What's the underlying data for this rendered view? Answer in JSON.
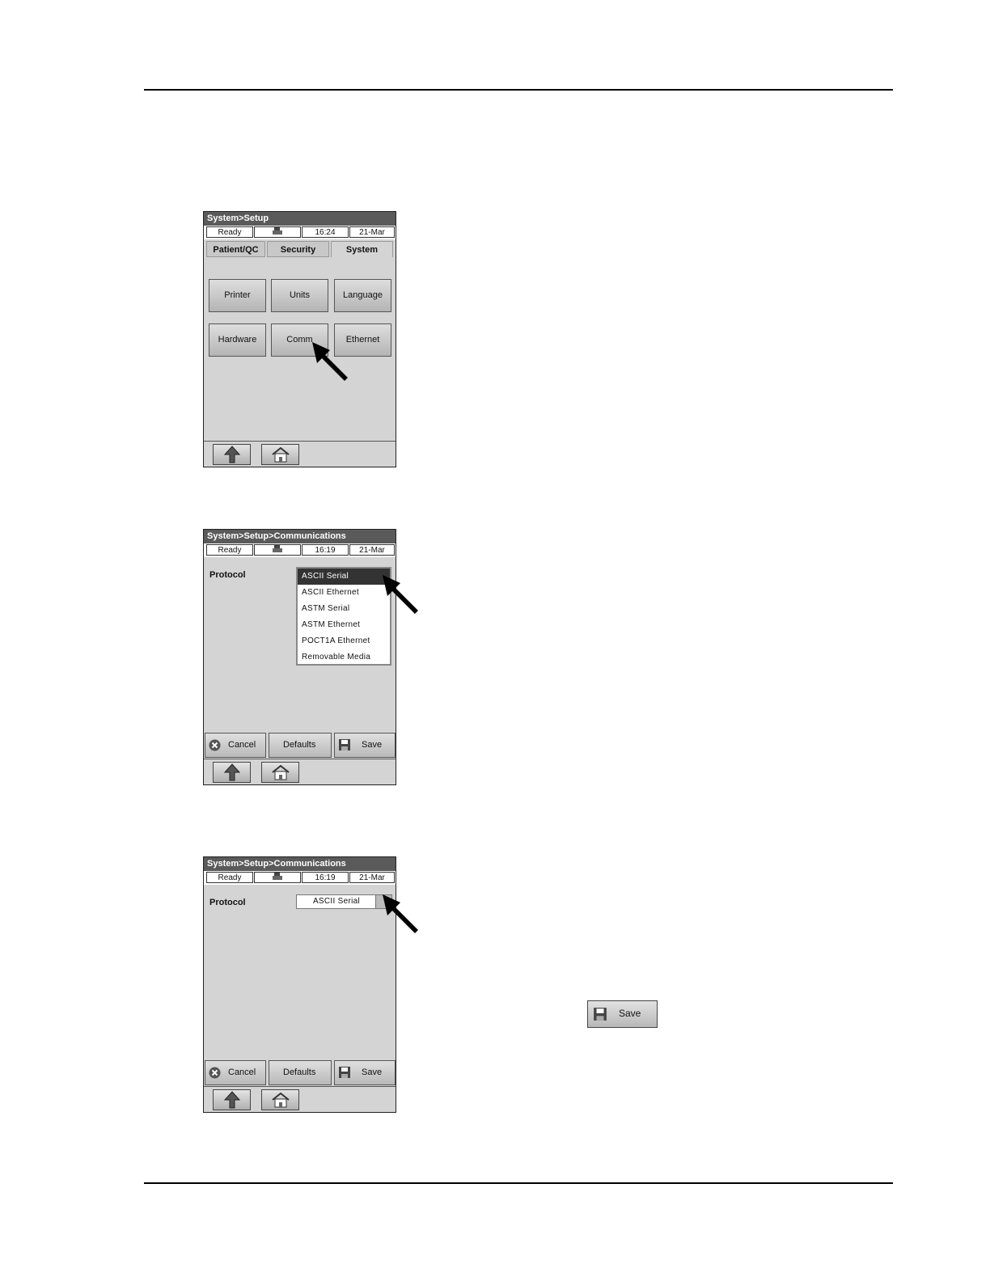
{
  "statusbar": {
    "ready": "Ready",
    "date": "21-Mar"
  },
  "screen1": {
    "title": "System>Setup",
    "time": "16:24",
    "tabs": [
      "Patient/QC",
      "Security",
      "System"
    ],
    "buttons": [
      "Printer",
      "Units",
      "Language",
      "Hardware",
      "Comm",
      "Ethernet"
    ]
  },
  "screen2": {
    "title": "System>Setup>Communications",
    "time": "16:19",
    "protocol_label": "Protocol",
    "options": [
      "ASCII Serial",
      "ASCII Ethernet",
      "ASTM Serial",
      "ASTM Ethernet",
      "POCT1A Ethernet",
      "Removable Media"
    ],
    "selected": "ASCII Serial"
  },
  "screen3": {
    "title": "System>Setup>Communications",
    "time": "16:19",
    "protocol_label": "Protocol",
    "value": "ASCII Serial"
  },
  "actions": {
    "cancel": "Cancel",
    "defaults": "Defaults",
    "save": "Save"
  },
  "save_button_label": "Save",
  "icons": [
    "printer-status-icon",
    "up-arrow-icon",
    "home-icon",
    "cancel-x-icon",
    "save-disk-icon",
    "pointer-arrow-icon",
    "chevron-down-icon"
  ]
}
